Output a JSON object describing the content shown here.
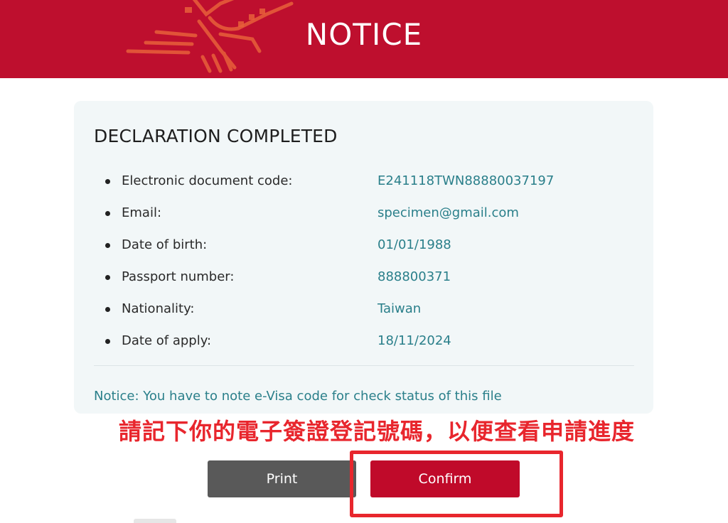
{
  "header": {
    "title": "NOTICE",
    "background_color": "#be0f2e"
  },
  "card": {
    "title": "DECLARATION COMPLETED",
    "items": [
      {
        "label": "Electronic document code:",
        "value": "E241118TWN88880037197"
      },
      {
        "label": "Email:",
        "value": "specimen@gmail.com"
      },
      {
        "label": "Date of birth:",
        "value": "01/01/1988"
      },
      {
        "label": "Passport number:",
        "value": "888800371"
      },
      {
        "label": "Nationality:",
        "value": "Taiwan"
      },
      {
        "label": "Date of apply:",
        "value": "18/11/2024"
      }
    ],
    "notice": "Notice: You have to note e-Visa code for check status of this file",
    "value_color": "#2a7f8a"
  },
  "annotation": {
    "text": "請記下你的電子簽證登記號碼，以便查看申請進度",
    "color": "#e8262d"
  },
  "buttons": {
    "print_label": "Print",
    "confirm_label": "Confirm",
    "confirm_color": "#c00a2a",
    "print_color": "#595959"
  }
}
